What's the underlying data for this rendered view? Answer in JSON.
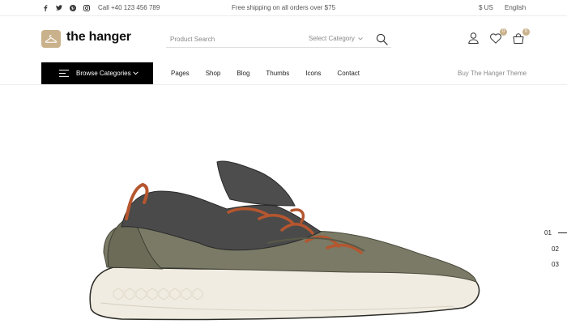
{
  "topbar": {
    "social": [
      "facebook-icon",
      "twitter-icon",
      "pinterest-icon",
      "instagram-icon"
    ],
    "phone": "Call +40 123 456 789",
    "shipping": "Free shipping on all orders over $75",
    "currency": "$ US",
    "language": "English"
  },
  "header": {
    "logo": "the hanger",
    "search": {
      "placeholder": "Product Search",
      "category": "Select Category"
    },
    "wishlist_count": "0",
    "cart_count": "0"
  },
  "nav": {
    "browse": "Browse Categories",
    "items": [
      "Pages",
      "Shop",
      "Blog",
      "Thumbs",
      "Icons",
      "Contact"
    ],
    "buy": "Buy The Hanger Theme"
  },
  "slider": {
    "numbers": [
      "01",
      "02",
      "03"
    ],
    "active": "01"
  },
  "colors": {
    "accent": "#c9b18b",
    "shoe_upper": "#7a7a66",
    "shoe_sole": "#f1ece1",
    "laces": "#b5562f"
  }
}
